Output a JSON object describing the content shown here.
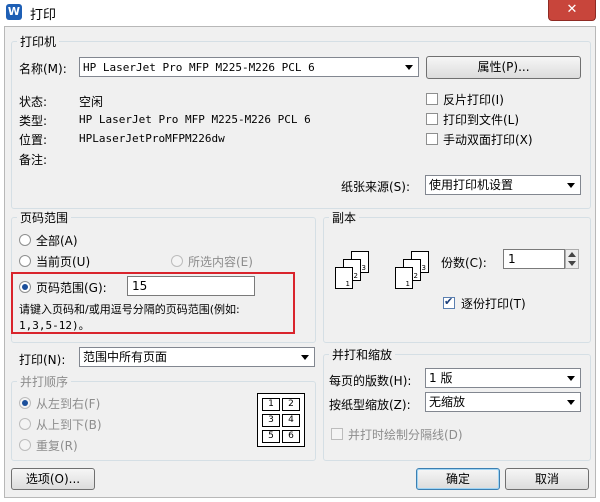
{
  "window": {
    "title": "打印",
    "app_icon": "W",
    "close_glyph": "✕"
  },
  "printer": {
    "group_label": "打印机",
    "name_label": "名称(M):",
    "name_value": "HP LaserJet Pro MFP M225-M226 PCL 6",
    "properties_button": "属性(P)...",
    "status_label": "状态:",
    "status_value": "空闲",
    "type_label": "类型:",
    "type_value": "HP LaserJet Pro MFP M225-M226 PCL 6",
    "location_label": "位置:",
    "location_value": "HPLaserJetProMFPM226dw",
    "comment_label": "备注:",
    "reverse_print": "反片打印(I)",
    "print_to_file": "打印到文件(L)",
    "manual_duplex": "手动双面打印(X)",
    "paper_source_label": "纸张来源(S):",
    "paper_source_value": "使用打印机设置"
  },
  "page_range": {
    "group_label": "页码范围",
    "all": "全部(A)",
    "current_page": "当前页(U)",
    "selection": "所选内容(E)",
    "pages_label": "页码范围(G):",
    "pages_value": "15",
    "hint": "请键入页码和/或用逗号分隔的页码范围(例如:",
    "hint_example": "1,3,5-12)。",
    "selected": "pages"
  },
  "copies": {
    "group_label": "副本",
    "count_label": "份数(C):",
    "count_value": "1",
    "collate": "逐份打印(T)",
    "collate_checked": true,
    "stack_pages": [
      "1",
      "2",
      "3"
    ]
  },
  "print_what": {
    "label": "打印(N):",
    "value": "范围中所有页面",
    "order_label": "并打顺序",
    "left_to_right": "从左到右(F)",
    "top_to_bottom": "从上到下(B)",
    "repeat": "重复(R)",
    "layout_numbers": [
      "1",
      "2",
      "3",
      "4",
      "5",
      "6"
    ]
  },
  "zoom": {
    "group_label": "并打和缩放",
    "pages_per_sheet_label": "每页的版数(H):",
    "pages_per_sheet_value": "1 版",
    "scale_label": "按纸型缩放(Z):",
    "scale_value": "无缩放",
    "draw_separator": "并打时绘制分隔线(D)"
  },
  "footer": {
    "options_button": "选项(O)...",
    "ok_button": "确定",
    "cancel_button": "取消"
  },
  "colors": {
    "highlight": "#d9242c",
    "accent": "#1b4f9b",
    "close": "#c8453b"
  }
}
